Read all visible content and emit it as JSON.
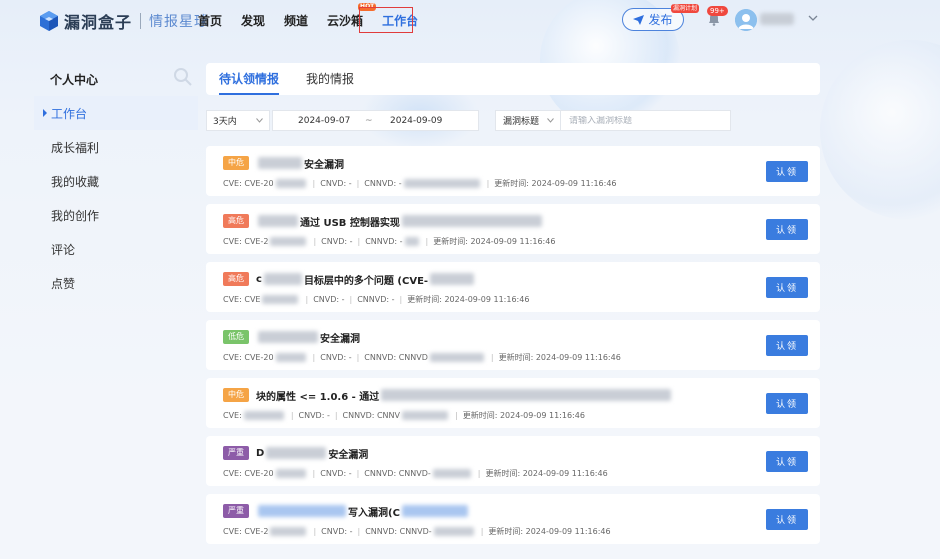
{
  "brand": {
    "name": "漏洞盒子",
    "sub": "情报星球"
  },
  "nav": {
    "items": [
      {
        "label": "首页"
      },
      {
        "label": "发现"
      },
      {
        "label": "频道"
      },
      {
        "label": "云沙箱",
        "badge": "HOT"
      },
      {
        "label": "工作台"
      }
    ],
    "active": "工作台"
  },
  "header": {
    "publish_label": "发布",
    "publish_badge": "漏洞计划",
    "notif_count": "99+"
  },
  "sidebar": {
    "title": "个人中心",
    "items": [
      {
        "label": "工作台"
      },
      {
        "label": "成长福利"
      },
      {
        "label": "我的收藏"
      },
      {
        "label": "我的创作"
      },
      {
        "label": "评论"
      },
      {
        "label": "点赞"
      }
    ],
    "active": "工作台"
  },
  "tabs": [
    {
      "label": "待认领情报"
    },
    {
      "label": "我的情报"
    }
  ],
  "filters": {
    "range": "3天内",
    "date_start": "2024-09-07",
    "date_sep": "~",
    "date_end": "2024-09-09",
    "type": "漏洞标题",
    "search_placeholder": "请输入漏洞标题"
  },
  "claim_label": "认领",
  "cards": [
    {
      "severity": "中危",
      "title_a": "",
      "title_b": "安全漏洞",
      "cve": "CVE-20",
      "cnvd": "CNVD: -",
      "cnnvd": "CNNVD: -",
      "updated": "更新时间: 2024-09-09 11:16:46"
    },
    {
      "severity": "高危",
      "title_a": "",
      "title_b": "通过 USB 控制器实现",
      "cve": "CVE-2",
      "cnvd": "CNVD: -",
      "cnnvd": "CNNVD: -",
      "updated": "更新时间: 2024-09-09 11:16:46"
    },
    {
      "severity": "高危",
      "title_a": "c",
      "title_b": "目标层中的多个问题 (CVE-",
      "cve": "CVE",
      "cnvd": "CNVD: -",
      "cnnvd": "CNNVD: -",
      "updated": "更新时间: 2024-09-09 11:16:46"
    },
    {
      "severity": "低危",
      "title_a": "",
      "title_b": "安全漏洞",
      "cve": "CVE-20",
      "cnvd": "CNVD: -",
      "cnnvd": "CNNVD: CNNVD",
      "updated": "更新时间: 2024-09-09 11:16:46"
    },
    {
      "severity": "中危",
      "title_a": "",
      "title_b": "块的属性 <= 1.0.6 - 通过",
      "cve": "CVE:",
      "cnvd": "CNVD: -",
      "cnnvd": "CNNVD: CNNV",
      "updated": "更新时间: 2024-09-09 11:16:46"
    },
    {
      "severity": "严重",
      "title_a": "D",
      "title_b": "安全漏洞",
      "cve": "CVE-20",
      "cnvd": "CNVD: -",
      "cnnvd": "CNNVD: CNNVD-",
      "updated": "更新时间: 2024-09-09 11:16:46"
    },
    {
      "severity": "严重",
      "title_a": "",
      "title_b": "写入漏洞(C",
      "cve": "CVE-2",
      "cnvd": "CNVD: -",
      "cnnvd": "CNNVD: CNNVD-",
      "updated": "更新时间: 2024-09-09 11:16:46"
    }
  ],
  "colors": {
    "accent": "#2f6fde",
    "mid": "#f5a446",
    "high": "#f07a5a",
    "low": "#7ac46a",
    "critical": "#8d5ca8"
  }
}
